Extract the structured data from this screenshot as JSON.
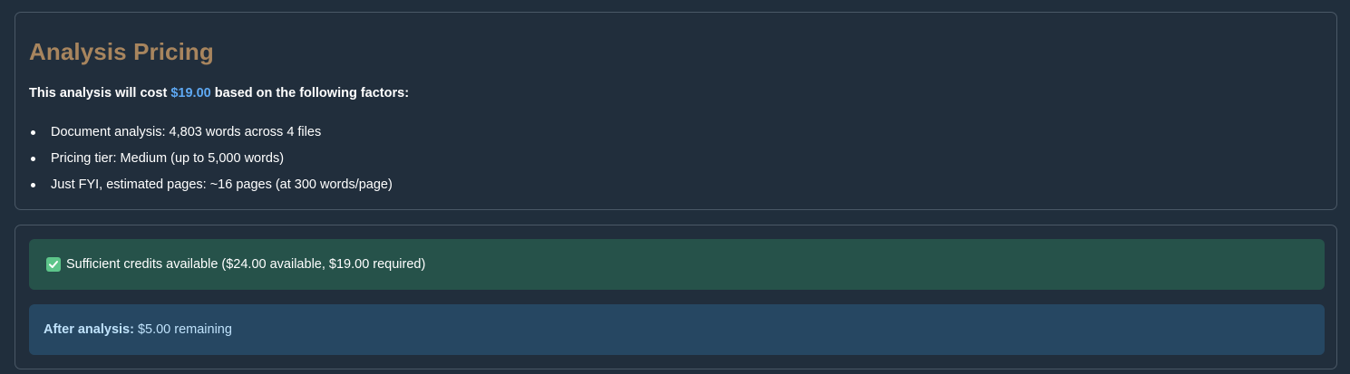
{
  "pricing": {
    "title": "Analysis Pricing",
    "intro_prefix": "This analysis will cost ",
    "cost": "$19.00",
    "intro_suffix": " based on the following factors:",
    "factors": [
      "Document analysis: 4,803 words across 4 files",
      "Pricing tier: Medium (up to 5,000 words)",
      "Just FYI, estimated pages: ~16 pages (at 300 words/page)"
    ]
  },
  "credits": {
    "status_icon": "check-icon",
    "status_text": "Sufficient credits available ($24.00 available, $19.00 required)",
    "after_label": "After analysis:",
    "after_value": "$5.00 remaining"
  },
  "colors": {
    "background": "#202e3c",
    "title": "#a8855e",
    "cost_highlight": "#5ea8f2",
    "success_bg": "#26524a",
    "info_bg": "#264762",
    "info_text": "#bfe2fb"
  }
}
